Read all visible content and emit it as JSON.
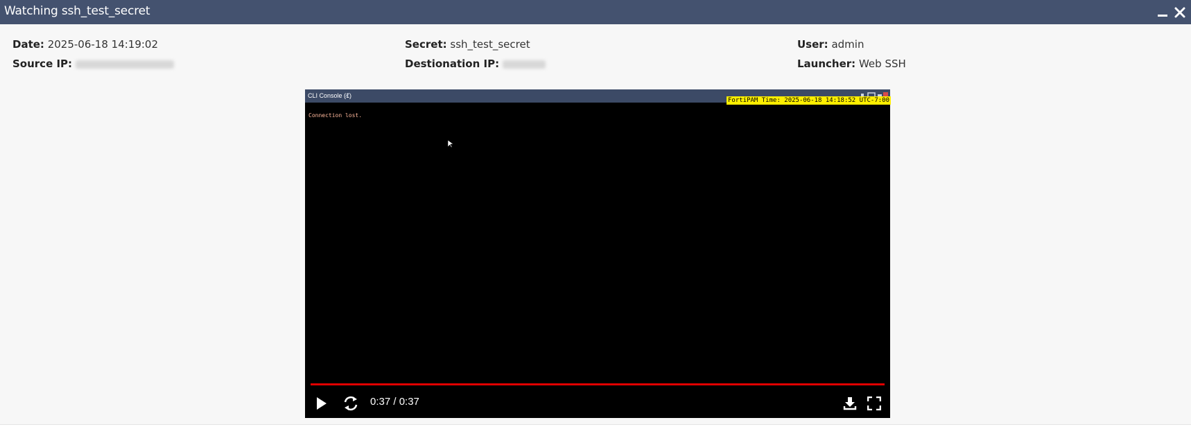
{
  "window": {
    "title": "Watching ssh_test_secret",
    "header_color": "#44526f"
  },
  "info": {
    "date_label": "Date:",
    "date_value": "2025-06-18 14:19:02",
    "source_ip_label": "Source IP:",
    "secret_label": "Secret:",
    "secret_value": "ssh_test_secret",
    "destination_ip_label": "Destionation IP:",
    "user_label": "User:",
    "user_value": "admin",
    "launcher_label": "Launcher:",
    "launcher_value": "Web SSH"
  },
  "console": {
    "tab_title": "CLI Console (1)",
    "fortipam_time": "FortiPAM Time: 2025-06-18 14:18:52 UTC-7:00",
    "output": "Connection lost."
  },
  "player": {
    "time_display": "0:37 / 0:37",
    "progress": 1.0,
    "progress_color": "#e00000",
    "icons": {
      "play": "play-icon",
      "replay": "replay-icon",
      "download": "download-icon",
      "fullscreen": "fullscreen-icon"
    }
  }
}
